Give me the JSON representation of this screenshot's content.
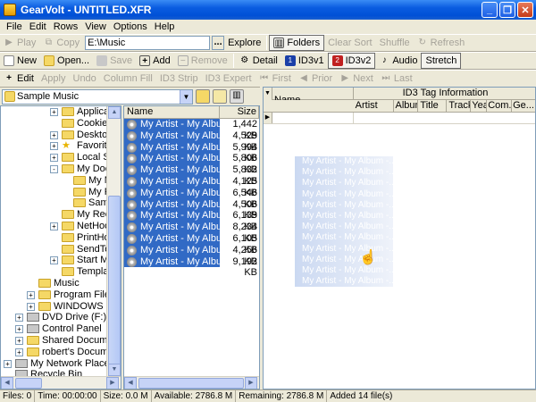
{
  "window": {
    "title": "GearVolt - UNTITLED.XFR"
  },
  "menu": [
    "File",
    "Edit",
    "Rows",
    "View",
    "Options",
    "Help"
  ],
  "toolbar1": {
    "play": "Play",
    "copy": "Copy",
    "path": "E:\\Music",
    "dots": "...",
    "explore": "Explore",
    "folders": "Folders",
    "clear_sort": "Clear Sort",
    "shuffle": "Shuffle",
    "refresh": "Refresh"
  },
  "toolbar2": {
    "new": "New",
    "open": "Open...",
    "save": "Save",
    "add": "Add",
    "remove": "Remove",
    "detail": "Detail",
    "id3v1": "ID3v1",
    "id3v2": "ID3v2",
    "audio": "Audio",
    "stretch": "Stretch"
  },
  "toolbar3": {
    "edit": "Edit",
    "apply": "Apply",
    "undo": "Undo",
    "column_fill": "Column Fill",
    "id3_strip": "ID3 Strip",
    "id3_expert": "ID3 Expert",
    "first": "First",
    "prior": "Prior",
    "next": "Next",
    "last": "Last"
  },
  "folder_combo": "Sample Music",
  "tree": [
    {
      "label": "Applicatio",
      "indent": 4,
      "toggle": "+",
      "icon": "folder"
    },
    {
      "label": "Cookies",
      "indent": 4,
      "toggle": "",
      "icon": "folder"
    },
    {
      "label": "Desktop",
      "indent": 4,
      "toggle": "+",
      "icon": "folder"
    },
    {
      "label": "Favorites",
      "indent": 4,
      "toggle": "+",
      "icon": "star"
    },
    {
      "label": "Local Set",
      "indent": 4,
      "toggle": "+",
      "icon": "folder"
    },
    {
      "label": "My Docu",
      "indent": 4,
      "toggle": "-",
      "icon": "folder-open"
    },
    {
      "label": "My M",
      "indent": 5,
      "toggle": "",
      "icon": "folder"
    },
    {
      "label": "My Pi",
      "indent": 5,
      "toggle": "",
      "icon": "folder"
    },
    {
      "label": "Samp",
      "indent": 5,
      "toggle": "",
      "icon": "folder-open"
    },
    {
      "label": "My Recen",
      "indent": 4,
      "toggle": "",
      "icon": "folder"
    },
    {
      "label": "NetHood",
      "indent": 4,
      "toggle": "+",
      "icon": "folder"
    },
    {
      "label": "PrintHood",
      "indent": 4,
      "toggle": "",
      "icon": "folder"
    },
    {
      "label": "SendTo",
      "indent": 4,
      "toggle": "",
      "icon": "folder"
    },
    {
      "label": "Start Mer",
      "indent": 4,
      "toggle": "+",
      "icon": "folder"
    },
    {
      "label": "Template",
      "indent": 4,
      "toggle": "",
      "icon": "folder"
    },
    {
      "label": "Music",
      "indent": 2,
      "toggle": "",
      "icon": "folder"
    },
    {
      "label": "Program Files",
      "indent": 2,
      "toggle": "+",
      "icon": "folder"
    },
    {
      "label": "WINDOWS",
      "indent": 2,
      "toggle": "+",
      "icon": "folder"
    },
    {
      "label": "DVD Drive (F:)",
      "indent": 1,
      "toggle": "+",
      "icon": "drive"
    },
    {
      "label": "Control Panel",
      "indent": 1,
      "toggle": "+",
      "icon": "drive"
    },
    {
      "label": "Shared Documents",
      "indent": 1,
      "toggle": "+",
      "icon": "folder"
    },
    {
      "label": "robert's Documents",
      "indent": 1,
      "toggle": "+",
      "icon": "folder"
    },
    {
      "label": "My Network Places",
      "indent": 0,
      "toggle": "+",
      "icon": "drive"
    },
    {
      "label": "Recycle Bin",
      "indent": 0,
      "toggle": "",
      "icon": "drive"
    }
  ],
  "filelist": {
    "columns": {
      "name": "Name",
      "size": "Size"
    },
    "rows": [
      {
        "name": "My Artist - My Album -...",
        "size": "1,442 KB"
      },
      {
        "name": "My Artist - My Album -...",
        "size": "4,529 KB"
      },
      {
        "name": "My Artist - My Album -...",
        "size": "5,994 KB"
      },
      {
        "name": "My Artist - My Album -...",
        "size": "5,806 KB"
      },
      {
        "name": "My Artist - My Album -...",
        "size": "5,832 KB"
      },
      {
        "name": "My Artist - My Album -...",
        "size": "4,125 KB"
      },
      {
        "name": "My Artist - My Album -...",
        "size": "6,546 KB"
      },
      {
        "name": "My Artist - My Album -...",
        "size": "4,506 KB"
      },
      {
        "name": "My Artist - My Album -...",
        "size": "6,139 KB"
      },
      {
        "name": "My Artist - My Album -...",
        "size": "8,234 KB"
      },
      {
        "name": "My Artist - My Album -...",
        "size": "6,105 KB"
      },
      {
        "name": "My Artist - My Album -...",
        "size": "4,256 KB"
      },
      {
        "name": "My Artist - My Album -...",
        "size": "9,192 KB"
      }
    ]
  },
  "drag_ghost": [
    "My Artist - My Album -...",
    "My Artist - My Album -...",
    "My Artist - My Album -...",
    "My Artist - My Album -...",
    "My Artist - My Album -...",
    "My Artist - My Album -...",
    "My Artist - My Album -...",
    "My Artist - My Album -...",
    "My Artist - My Album -...",
    "My Artist - My Album -...",
    "My Artist - My Album -...",
    "My Artist - My Album -..."
  ],
  "id3grid": {
    "group_header": "ID3 Tag Information",
    "name_header": "Name",
    "columns": [
      "Artist",
      "Album",
      "Title",
      "Track",
      "Year",
      "Com...",
      "Ge..."
    ]
  },
  "status": {
    "files": "Files: 0",
    "time": "Time: 00:00:00",
    "size": "Size: 0.0 M",
    "available": "Available: 2786.8 M",
    "remaining": "Remaining: 2786.8 M",
    "added": "Added 14 file(s)"
  },
  "colors": {
    "title_blue": "#0a5ce0",
    "selection": "#316ac5",
    "face": "#ece9d8"
  }
}
